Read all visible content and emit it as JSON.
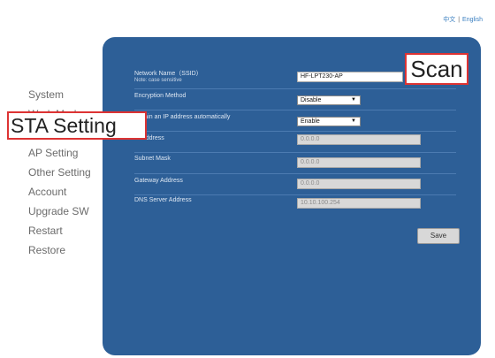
{
  "header": {
    "lang_chinese": "中文",
    "lang_separator": "|",
    "lang_english": "English"
  },
  "sidebar": {
    "items": [
      {
        "label": "System"
      },
      {
        "label": "Work Mode"
      },
      {
        "label": "STA Setting"
      },
      {
        "label": "AP Setting"
      },
      {
        "label": "Other Setting"
      },
      {
        "label": "Account"
      },
      {
        "label": "Upgrade SW"
      },
      {
        "label": "Restart"
      },
      {
        "label": "Restore"
      }
    ]
  },
  "form": {
    "ssid_label": "Network Name（SSID）",
    "ssid_note": "Note: case sensitive",
    "ssid_value": "HF-LPT230-AP",
    "scan_label": "Scan",
    "encryption_label": "Encryption Method",
    "encryption_value": "Disable",
    "dhcp_label": "Obtain an IP address automatically",
    "dhcp_value": "Enable",
    "ip_label": "IP Address",
    "ip_value": "0.0.0.0",
    "mask_label": "Subnet Mask",
    "mask_value": "0.0.0.0",
    "gateway_label": "Gateway Address",
    "gateway_value": "0.0.0.0",
    "dns_label": "DNS Server Address",
    "dns_value": "10.10.100.254",
    "save_label": "Save"
  },
  "colors": {
    "panel": "#2d5f97",
    "highlight_border": "#dd3333"
  }
}
